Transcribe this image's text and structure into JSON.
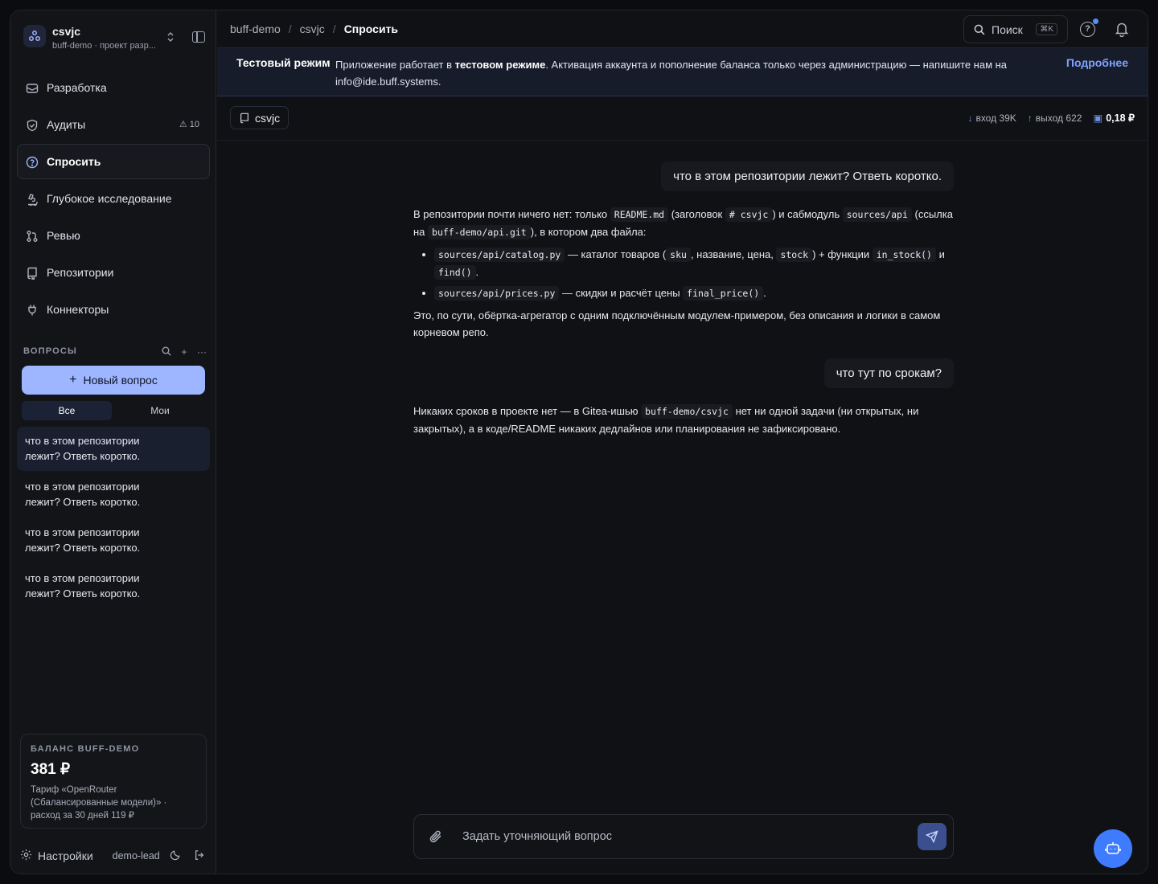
{
  "project": {
    "name": "csvjc",
    "subtitle": "buff-demo · проект разр..."
  },
  "nav": {
    "items": [
      {
        "label": "Разработка",
        "icon": "code-icon"
      },
      {
        "label": "Аудиты",
        "icon": "shield-icon",
        "badge": "10"
      },
      {
        "label": "Спросить",
        "icon": "help-circle-icon",
        "active": true
      },
      {
        "label": "Глубокое исследование",
        "icon": "microscope-icon"
      },
      {
        "label": "Ревью",
        "icon": "git-pull-request-icon"
      },
      {
        "label": "Репозитории",
        "icon": "repo-icon"
      },
      {
        "label": "Коннекторы",
        "icon": "plug-icon"
      }
    ]
  },
  "questions": {
    "section_title": "ВОПРОСЫ",
    "new_button": "Новый вопрос",
    "filters": [
      "Все",
      "Мои"
    ],
    "items": [
      "что в этом репозитории лежит? Ответь коротко.",
      "что в этом репозитории лежит? Ответь коротко.",
      "что в этом репозитории лежит? Ответь коротко.",
      "что в этом репозитории лежит? Ответь коротко."
    ]
  },
  "balance": {
    "title": "БАЛАНС BUFF-DEMO",
    "amount": "381 ₽",
    "note": "Тариф «OpenRouter (Сбалансированные модели)» · расход за 30 дней 119 ₽"
  },
  "footer": {
    "settings": "Настройки",
    "user": "demo-lead"
  },
  "breadcrumbs": [
    "buff-demo",
    "csvjc",
    "Спросить"
  ],
  "search": {
    "label": "Поиск",
    "shortcut": "⌘K"
  },
  "banner": {
    "title": "Тестовый режим",
    "text_1": "Приложение работает в ",
    "text_bold": "тестовом режиме",
    "text_2": ". Активация аккаунта и пополнение баланса только через администрацию — напишите нам на info@ide.buff.systems.",
    "link": "Подробнее"
  },
  "chat": {
    "repo": "csvjc",
    "tokens_in": "вход 39K",
    "tokens_out": "выход 622",
    "cost": "0,18 ₽"
  },
  "conversation": {
    "q1": "что в этом репозитории лежит? Ответь коротко.",
    "a1": {
      "p1_a": "В репозитории почти ничего нет: только ",
      "p1_c1": "README.md",
      "p1_b": " (заголовок ",
      "p1_c2": "# csvjc",
      "p1_c": ") и сабмодуль ",
      "p1_c3": "sources/api",
      "p1_d": " (ссылка на ",
      "p1_c4": "buff-demo/api.git",
      "p1_e": "), в котором два файла:",
      "li1_c1": "sources/api/catalog.py",
      "li1_a": " — каталог товаров (",
      "li1_c2": "sku",
      "li1_b": ", название, цена, ",
      "li1_c3": "stock",
      "li1_c": ") + функции ",
      "li1_c4": "in_stock()",
      "li1_d": " и ",
      "li1_c5": "find()",
      "li1_e": ".",
      "li2_c1": "sources/api/prices.py",
      "li2_a": " — скидки и расчёт цены ",
      "li2_c2": "final_price()",
      "li2_b": ".",
      "p2": "Это, по сути, обёртка-агрегатор с одним подключённым модулем-примером, без описания и логики в самом корневом репо."
    },
    "q2": "что тут по срокам?",
    "a2": {
      "a": "Никаких сроков в проекте нет — в Gitea-ишью ",
      "c1": "buff-demo/csvjc",
      "b": " нет ни одной задачи (ни открытых, ни закрытых), а в коде/README никаких дедлайнов или планирования не зафиксировано."
    }
  },
  "composer": {
    "placeholder": "Задать уточняющий вопрос"
  },
  "colors": {
    "accent": "#9db6ff",
    "link": "#7fa2ff",
    "fab": "#3f7bff",
    "banner_bg": "#171c2a"
  }
}
